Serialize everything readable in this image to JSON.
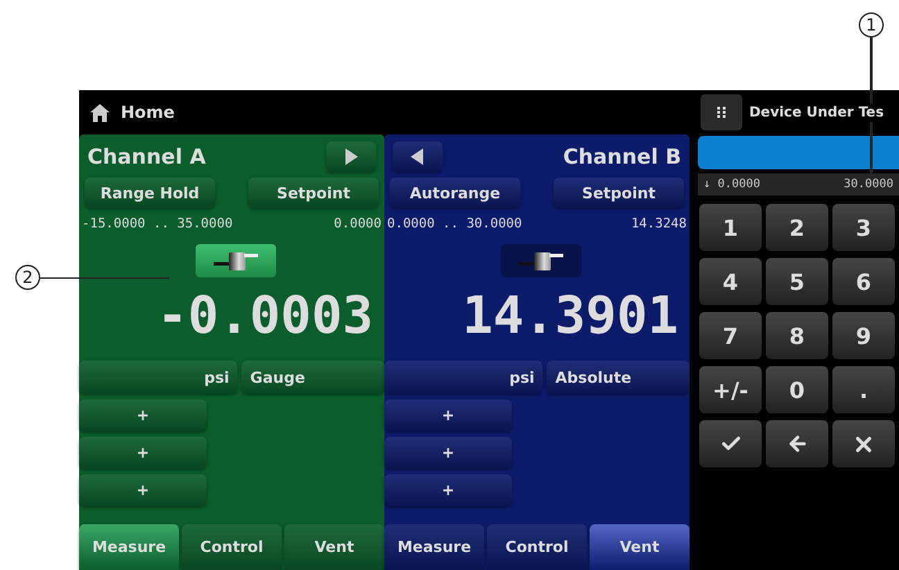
{
  "header": {
    "title": "Home"
  },
  "channels": [
    {
      "name": "Channel A",
      "color": "#0b5e2c",
      "nav_button": {
        "kind": "right"
      },
      "buttons": [
        "Range Hold",
        "Setpoint"
      ],
      "range": "-15.0000 .. 35.0000",
      "setpoint": "0.0000",
      "valve_active": true,
      "reading": "-0.0003",
      "unit": "psi",
      "mode": "Gauge",
      "plus_buttons": [
        "+",
        "+",
        "+"
      ],
      "tabs": [
        {
          "label": "Measure",
          "selected": true
        },
        {
          "label": "Control",
          "selected": false
        },
        {
          "label": "Vent",
          "selected": false
        }
      ]
    },
    {
      "name": "Channel B",
      "color": "#0c1c6b",
      "nav_button": {
        "kind": "left"
      },
      "buttons": [
        "Autorange",
        "Setpoint"
      ],
      "range": "0.0000 .. 30.0000",
      "setpoint": "14.3248",
      "valve_active": false,
      "reading": "14.3901",
      "unit": "psi",
      "mode": "Absolute",
      "plus_buttons": [
        "+",
        "+",
        "+"
      ],
      "tabs": [
        {
          "label": "Measure",
          "selected": false
        },
        {
          "label": "Control",
          "selected": false
        },
        {
          "label": "Vent",
          "selected": true
        }
      ]
    }
  ],
  "keypad": {
    "title": "Device Under Tes",
    "range_low": "↓ 0.0000",
    "range_high": "30.0000",
    "keys": [
      {
        "kind": "text",
        "label": "1"
      },
      {
        "kind": "text",
        "label": "2"
      },
      {
        "kind": "text",
        "label": "3"
      },
      {
        "kind": "text",
        "label": "4"
      },
      {
        "kind": "text",
        "label": "5"
      },
      {
        "kind": "text",
        "label": "6"
      },
      {
        "kind": "text",
        "label": "7"
      },
      {
        "kind": "text",
        "label": "8"
      },
      {
        "kind": "text",
        "label": "9"
      },
      {
        "kind": "text",
        "label": "+/-"
      },
      {
        "kind": "text",
        "label": "0"
      },
      {
        "kind": "text",
        "label": "."
      },
      {
        "kind": "enter"
      },
      {
        "kind": "back"
      },
      {
        "kind": "clear"
      }
    ]
  },
  "callouts": [
    {
      "label": "1"
    },
    {
      "label": "2"
    }
  ]
}
